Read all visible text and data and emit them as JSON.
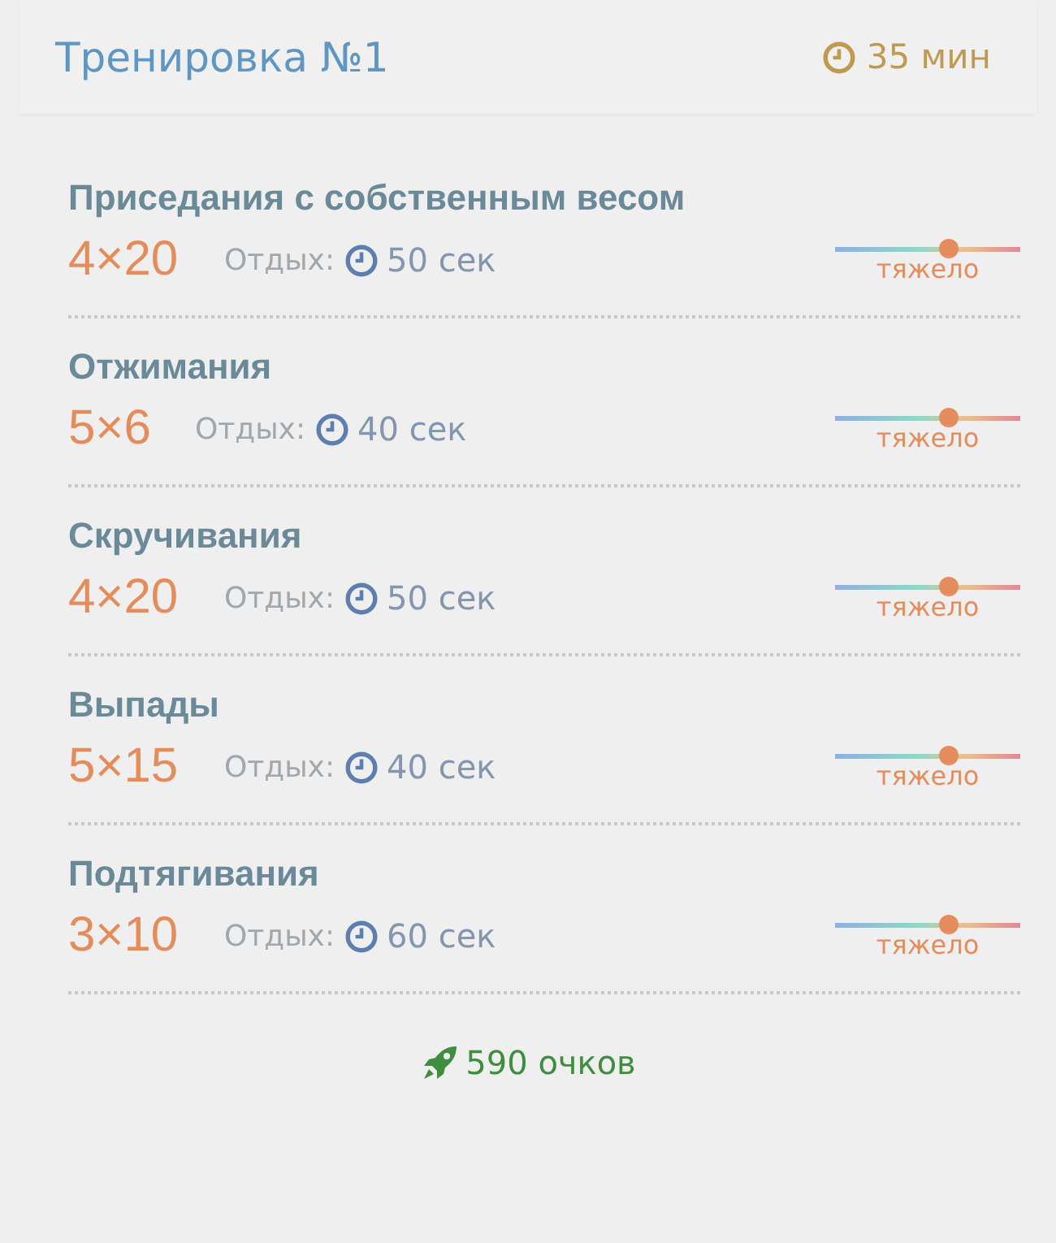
{
  "header": {
    "title": "Тренировка №1",
    "duration": "35 мин"
  },
  "exercises": [
    {
      "name": "Приседания с собственным весом",
      "sets": "4×20",
      "rest_label": "Отдых:",
      "rest": "50 сек",
      "level": 0.61,
      "difficulty": "тяжело"
    },
    {
      "name": "Отжимания",
      "sets": "5×6",
      "rest_label": "Отдых:",
      "rest": "40 сек",
      "level": 0.61,
      "difficulty": "тяжело"
    },
    {
      "name": "Скручивания",
      "sets": "4×20",
      "rest_label": "Отдых:",
      "rest": "50 сек",
      "level": 0.61,
      "difficulty": "тяжело"
    },
    {
      "name": "Выпады",
      "sets": "5×15",
      "rest_label": "Отдых:",
      "rest": "40 сек",
      "level": 0.61,
      "difficulty": "тяжело"
    },
    {
      "name": "Подтягивания",
      "sets": "3×10",
      "rest_label": "Отдых:",
      "rest": "60 сек",
      "level": 0.61,
      "difficulty": "тяжело"
    }
  ],
  "footer": {
    "points": "590 очков"
  }
}
